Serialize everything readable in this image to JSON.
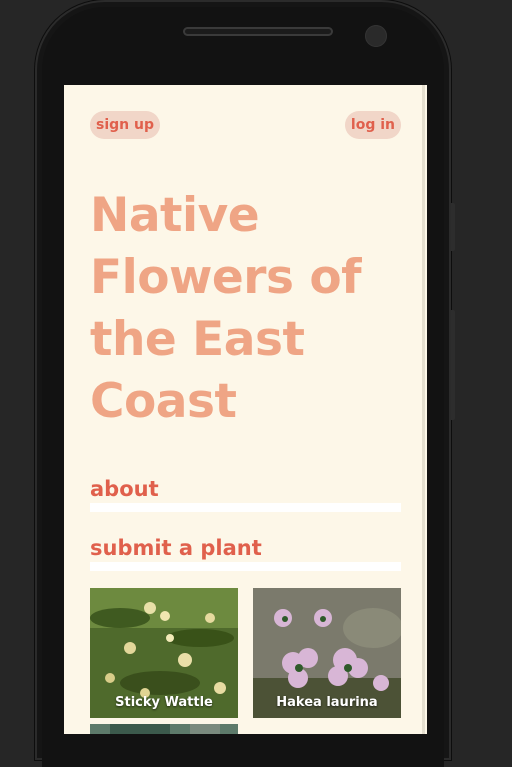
{
  "header": {
    "signup_label": "sign up",
    "login_label": "log in"
  },
  "hero": {
    "title_lines": [
      "Native",
      "Flowers of",
      "the East",
      "Coast"
    ]
  },
  "nav": {
    "about_label": "about",
    "submit_label": "submit a plant"
  },
  "plants": [
    {
      "name": "Sticky Wattle"
    },
    {
      "name": "Hakea laurina"
    }
  ],
  "colors": {
    "background": "#fdf7e8",
    "title": "#efa585",
    "accent": "#e0604c",
    "pill": "#f1d6c8"
  }
}
